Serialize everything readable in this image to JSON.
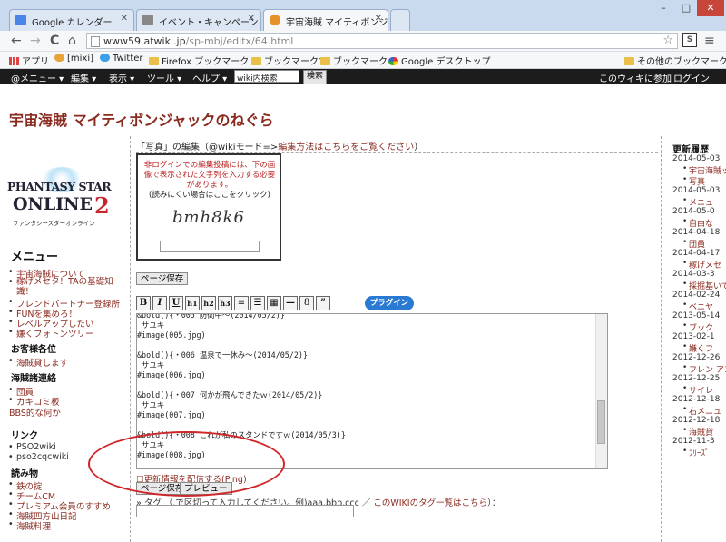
{
  "tabs": [
    {
      "label": "Google カレンダー",
      "color": "#4a86e8"
    },
    {
      "label": "イベント・キャンペーン",
      "color": "#888888"
    },
    {
      "label": "宇宙海賊 マイティボンジ",
      "color": "#e8902a"
    }
  ],
  "window_controls": {
    "minimize": "–",
    "maximize": "□",
    "close": "✕"
  },
  "nav": {
    "back": "←",
    "forward": "→",
    "reload": "C",
    "home": "⌂"
  },
  "url": {
    "host": "www59.atwiki.jp",
    "path": "/sp-mbj/editx/64.html"
  },
  "bookmarks": [
    {
      "label": "アプリ",
      "icon": "apps-icon"
    },
    {
      "label": "[mixi]",
      "icon": "mixi-icon"
    },
    {
      "label": "Twitter",
      "icon": "twitter-icon"
    },
    {
      "label": "Firefox ブックマーク",
      "icon": "folder-icon"
    },
    {
      "label": "ブックマーク1",
      "icon": "folder-icon"
    },
    {
      "label": "ブックマーク",
      "icon": "folder-icon"
    },
    {
      "label": "Google デスクトップ",
      "icon": "google-icon"
    },
    {
      "label": "その他のブックマーク",
      "icon": "folder-icon"
    }
  ],
  "wikimenu": {
    "items": [
      "@メニュー ▾",
      "編集 ▾",
      "表示 ▾",
      "ツール ▾",
      "ヘルプ ▾"
    ],
    "search_value": "wiki内検索",
    "search_button": "検索",
    "join": "このウィキに参加",
    "login": "ログイン"
  },
  "page_title": "宇宙海賊 マイティボンジャックのねぐら",
  "sidebar": {
    "logo_line1": "PHANTASY STAR",
    "logo_line2": "ONLINE",
    "logo_num": "2",
    "logo_sub": "ファンタシースターオンライン",
    "menu_heading": "メニュー",
    "menu_items": [
      "宇宙海賊について",
      "稼げメセタ！TAの基礎知識！",
      "フレンドパートナー登録所",
      "FUNを集めろ！",
      "レベルアップしたい",
      "嫌くフォトンツリー"
    ],
    "guests_heading": "お客様各位",
    "guests_items": [
      "海賊貸します"
    ],
    "contact_heading": "海賊諸連絡",
    "contact_items": [
      "団員",
      "カキコミ板",
      "BBS的な何か"
    ],
    "links_heading": "リンク",
    "links_items": [
      "PSO2wiki",
      "pso2cqcwiki"
    ],
    "reading_heading": "読み物",
    "reading_items": [
      "鉄の掟",
      "チームCM",
      "プレミアム会員のすすめ",
      "海賊四方山日記",
      "海賊料理"
    ]
  },
  "main": {
    "header_prefix": "「写真」の編集（@wikiモード=>",
    "header_link": "編集方法はこちらをご覧ください",
    "header_suffix": "）",
    "captcha_msg": "非ログインでの編集投稿には、下の画像で表示された文字列を入力する必要があります。",
    "captcha_hint": "(読みにくい場合はここをクリック)",
    "captcha_image": "bmh8k6",
    "save_button": "ページ保存",
    "toolbar": [
      "B",
      "I",
      "U",
      "h1",
      "h2",
      "h3",
      "≡",
      "☰",
      "▦",
      "—",
      "8",
      "”"
    ],
    "plugin_button": "プラグイン",
    "editor_text": "&bold(){・005 防衛中～(2014/05/2)}\n サユキ\n#image(005.jpg)\n\n&bold(){・006 温泉で一休み～(2014/05/2)}\n サユキ\n#image(006.jpg)\n\n&bold(){・007 何かが飛んできたｗ(2014/05/2)}\n サユキ\n#image(007.jpg)\n\n&bold(){・008 これが私のスタンドですｗ(2014/05/3)}\n サユキ\n#image(008.jpg)\n\n&bold(){・test (yyyy/mm/dd)}\n サユキ\n#image(test.jpg)",
    "notify": "更新情報を配信する(Ping)",
    "save_button2": "ページ保存",
    "preview_button": "プレビュー",
    "tag_text": "» タグ （,で区切って入力してください。例)aaa,bbb,ccc ／ ",
    "tag_link": "このWIKIのタグ一覧はこちら",
    "tag_suffix": "）："
  },
  "recent": {
    "heading": "更新履歴",
    "entries": [
      {
        "date": "2014-05-03",
        "item": "宇宙海賊ック"
      },
      {
        "date": "",
        "item": "写真"
      },
      {
        "date": "2014-05-03",
        "item": "メニュー"
      },
      {
        "date": "2014-05-0",
        "item": "自由な"
      },
      {
        "date": "2014-04-18",
        "item": "団員"
      },
      {
        "date": "2014-04-17",
        "item": "稼げメセ"
      },
      {
        "date": "2014-03-3",
        "item": "採掘基いて"
      },
      {
        "date": "2014-02-24",
        "item": "ベニヤ"
      },
      {
        "date": "2013-05-14",
        "item": "ブック"
      },
      {
        "date": "2013-02-1",
        "item": "嫌くフ"
      },
      {
        "date": "2012-12-26",
        "item": "フレン アンブ"
      },
      {
        "date": "2012-12-25",
        "item": "サイレ"
      },
      {
        "date": "2012-12-18",
        "item": "右メニュ"
      },
      {
        "date": "2012-12-18",
        "item": "海賊貸"
      },
      {
        "date": "2012-11-3",
        "item": "ﾌﾘｰｽﾞ"
      }
    ]
  }
}
